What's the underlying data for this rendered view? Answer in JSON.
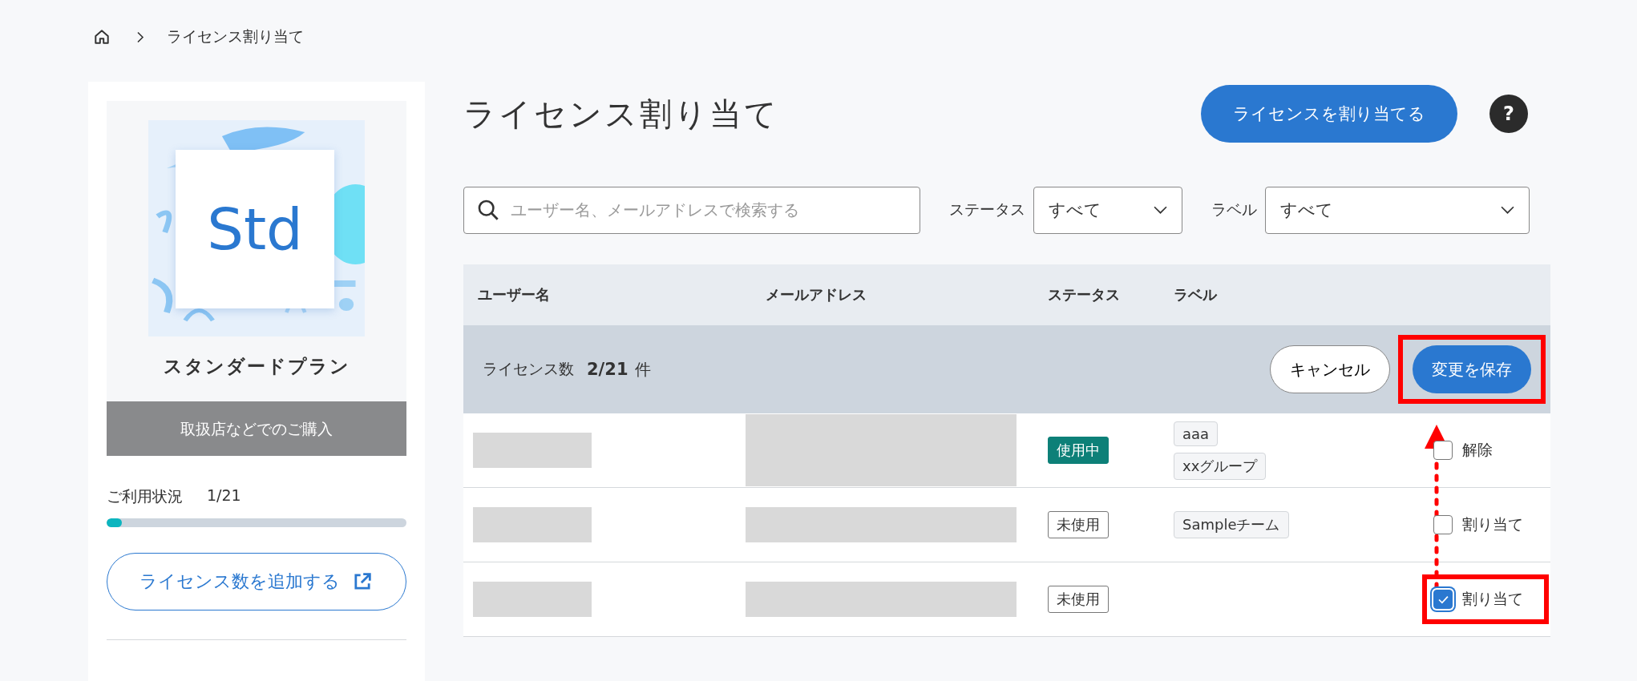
{
  "breadcrumb": {
    "current": "ライセンス割り当て"
  },
  "plan": {
    "logo_text": "Std",
    "name": "スタンダードプラン",
    "purchase": "取扱店などでのご購入",
    "usage_label": "ご利用状況",
    "usage_value": "1/21",
    "level": 0.05,
    "add_button": "ライセンス数を追加する"
  },
  "page_title": "ライセンス割り当て",
  "assign_button": "ライセンスを割り当てる",
  "help": "?",
  "search": {
    "placeholder": "ユーザー名、メールアドレスで検索する"
  },
  "filters": [
    {
      "label": "ステータス",
      "value": "すべて"
    },
    {
      "label": "ラベル",
      "value": "すべて"
    }
  ],
  "table": {
    "columns": [
      "ユーザー名",
      "メールアドレス",
      "ステータス",
      "ラベル"
    ],
    "license_count_label": "ライセンス数",
    "license_count": "2/21",
    "license_unit": "件",
    "cancel_button": "キャンセル",
    "save_button": {
      "label": "変更を保存",
      "highlighted": true
    },
    "rows": [
      {
        "status": "使用中",
        "kind": "active",
        "labels": [
          "aaa",
          "xxグループ"
        ],
        "action": "解除",
        "checked": false,
        "highlighted": false
      },
      {
        "status": "未使用",
        "kind": "inactive",
        "labels": [
          "Sampleチーム"
        ],
        "action": "割り当て",
        "checked": false,
        "highlighted": false
      },
      {
        "status": "未使用",
        "kind": "inactive",
        "labels": [],
        "action": "割り当て",
        "checked": true,
        "highlighted": true
      }
    ]
  }
}
